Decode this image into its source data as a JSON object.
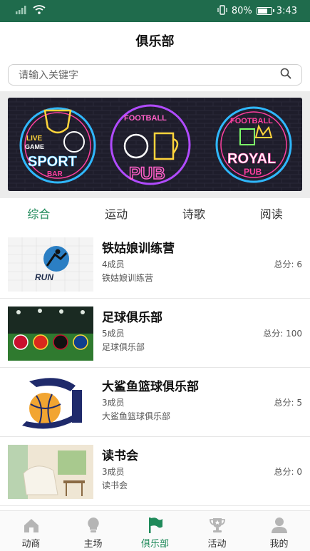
{
  "status_bar": {
    "battery_text": "80%",
    "time": "3:43",
    "battery_level": 0.8
  },
  "header": {
    "title": "俱乐部"
  },
  "search": {
    "placeholder": "请输入关键字"
  },
  "banner": {
    "sign1": {
      "line1": "LIVE",
      "line2": "GAME",
      "line3": "SPORT",
      "line4": "BAR"
    },
    "sign2": {
      "line1": "FOOTBALL",
      "line2": "PUB"
    },
    "sign3": {
      "line1": "FOOTBALL",
      "line2": "ROYAL",
      "line3": "PUB"
    }
  },
  "tabs": [
    {
      "label": "综合",
      "active": true
    },
    {
      "label": "运动",
      "active": false
    },
    {
      "label": "诗歌",
      "active": false
    },
    {
      "label": "阅读",
      "active": false
    }
  ],
  "clubs": [
    {
      "name": "铁姑娘训练营",
      "members": "4成员",
      "score": "总分: 6",
      "desc": "铁姑娘训练营",
      "thumb_text": "RUN"
    },
    {
      "name": "足球俱乐部",
      "members": "5成员",
      "score": "总分: 100",
      "desc": "足球俱乐部"
    },
    {
      "name": "大鲨鱼篮球俱乐部",
      "members": "3成员",
      "score": "总分: 5",
      "desc": "大鲨鱼篮球俱乐部"
    },
    {
      "name": "读书会",
      "members": "3成员",
      "score": "总分: 0",
      "desc": "读书会"
    }
  ],
  "nav": [
    {
      "label": "动商",
      "icon": "home-icon",
      "active": false
    },
    {
      "label": "主场",
      "icon": "lightbulb-icon",
      "active": false
    },
    {
      "label": "俱乐部",
      "icon": "flag-icon",
      "active": true
    },
    {
      "label": "活动",
      "icon": "trophy-icon",
      "active": false
    },
    {
      "label": "我的",
      "icon": "user-icon",
      "active": false
    }
  ],
  "colors": {
    "accent": "#1f8a5a",
    "status_bar": "#1f6b4c"
  }
}
